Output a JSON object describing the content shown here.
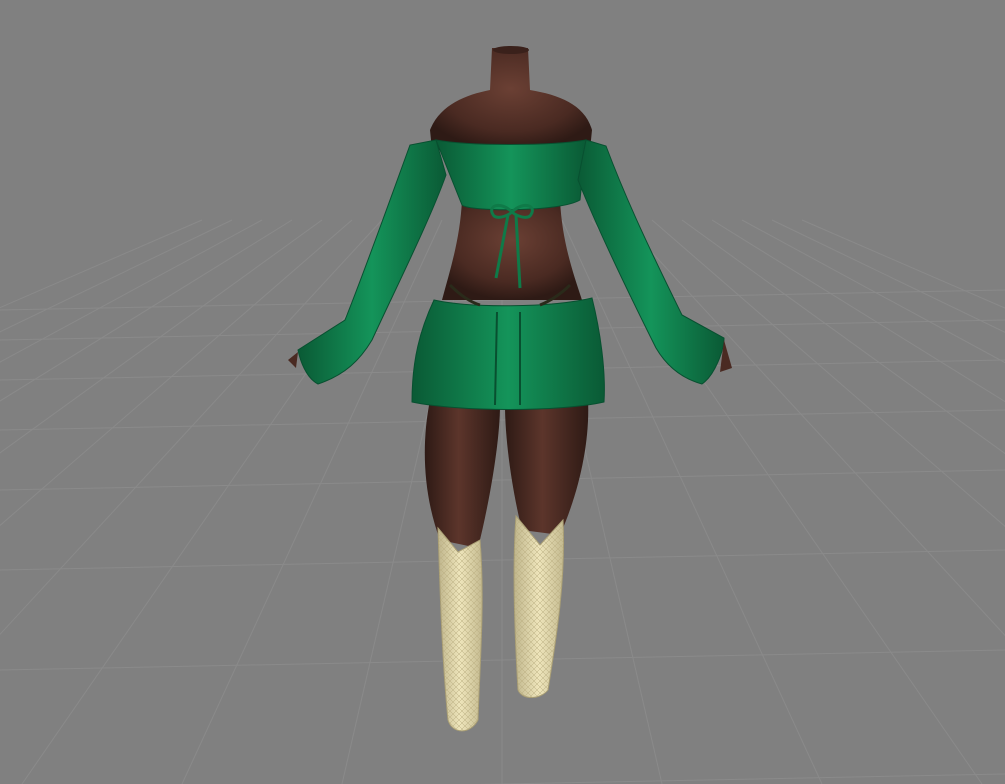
{
  "scene": {
    "background_color": "#808080",
    "grid_color": "#8a8a8a",
    "model": {
      "skin_color": "#4a2a22",
      "outfit_color": "#0f7a48",
      "boot_color": "#e6dcae"
    }
  }
}
